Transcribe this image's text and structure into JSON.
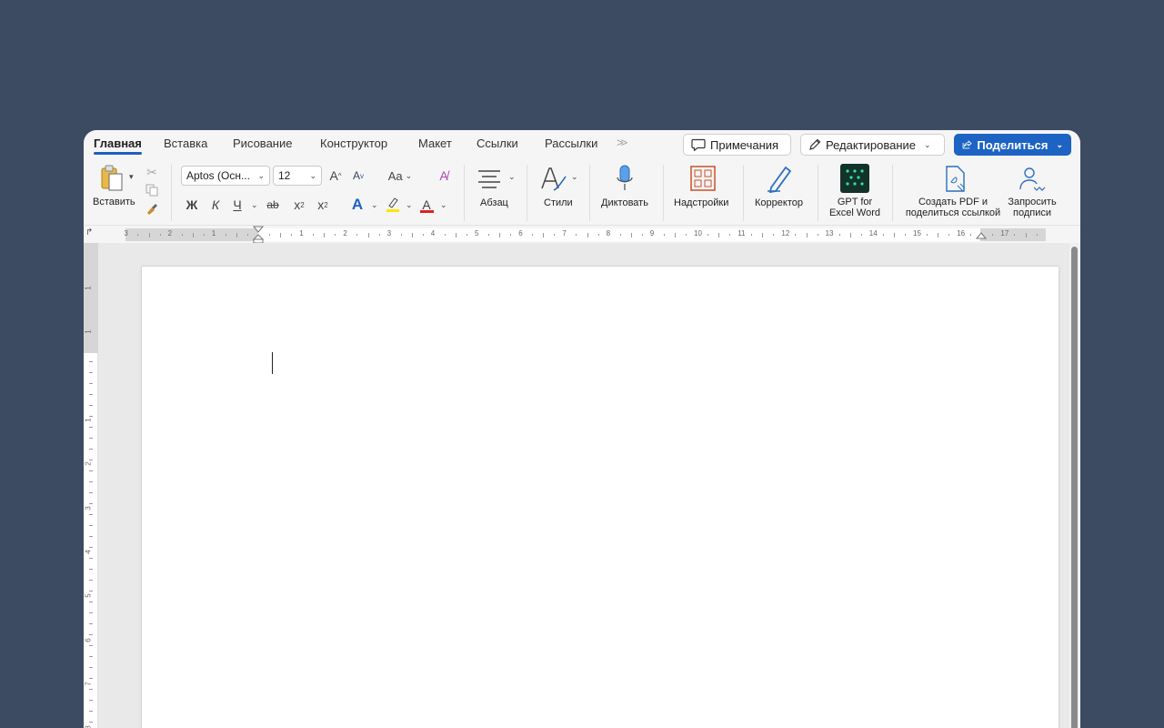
{
  "tabs": [
    "Главная",
    "Вставка",
    "Рисование",
    "Конструктор",
    "Макет",
    "Ссылки",
    "Рассылки"
  ],
  "tabs_more": ">>",
  "top_buttons": {
    "comments": "Примечания",
    "editing": "Редактирование",
    "share": "Поделиться"
  },
  "ribbon": {
    "paste": "Вставить",
    "font_name": "Aptos (Осн...",
    "font_size": "12",
    "grow_font": "A",
    "shrink_font": "A",
    "change_case": "Aa",
    "bold": "Ж",
    "italic": "К",
    "underline": "Ч",
    "strike": "ab",
    "subscript": "x",
    "superscript": "x",
    "font_color_letter": "A",
    "paragraph": "Абзац",
    "styles": "Стили",
    "dictate": "Диктовать",
    "addins": "Надстройки",
    "editor": "Корректор",
    "gpt": [
      "GPT for",
      "Excel Word"
    ],
    "pdf": [
      "Создать PDF и",
      "поделиться ссылкой"
    ],
    "signatures": [
      "Запросить",
      "подписи"
    ]
  },
  "hruler_numbers": [
    "3",
    "2",
    "1",
    "1",
    "2",
    "3",
    "4",
    "5",
    "6",
    "7",
    "8",
    "9",
    "10",
    "11",
    "12",
    "13",
    "14",
    "15",
    "16",
    "17"
  ],
  "vruler_numbers": [
    "1",
    "1",
    "1",
    "2",
    "3",
    "4",
    "5",
    "6",
    "7",
    "8"
  ],
  "colors": {
    "accent": "#1d63c4",
    "background": "#3c4b62",
    "highlight": "#ffe500",
    "font_color": "#e02020"
  }
}
